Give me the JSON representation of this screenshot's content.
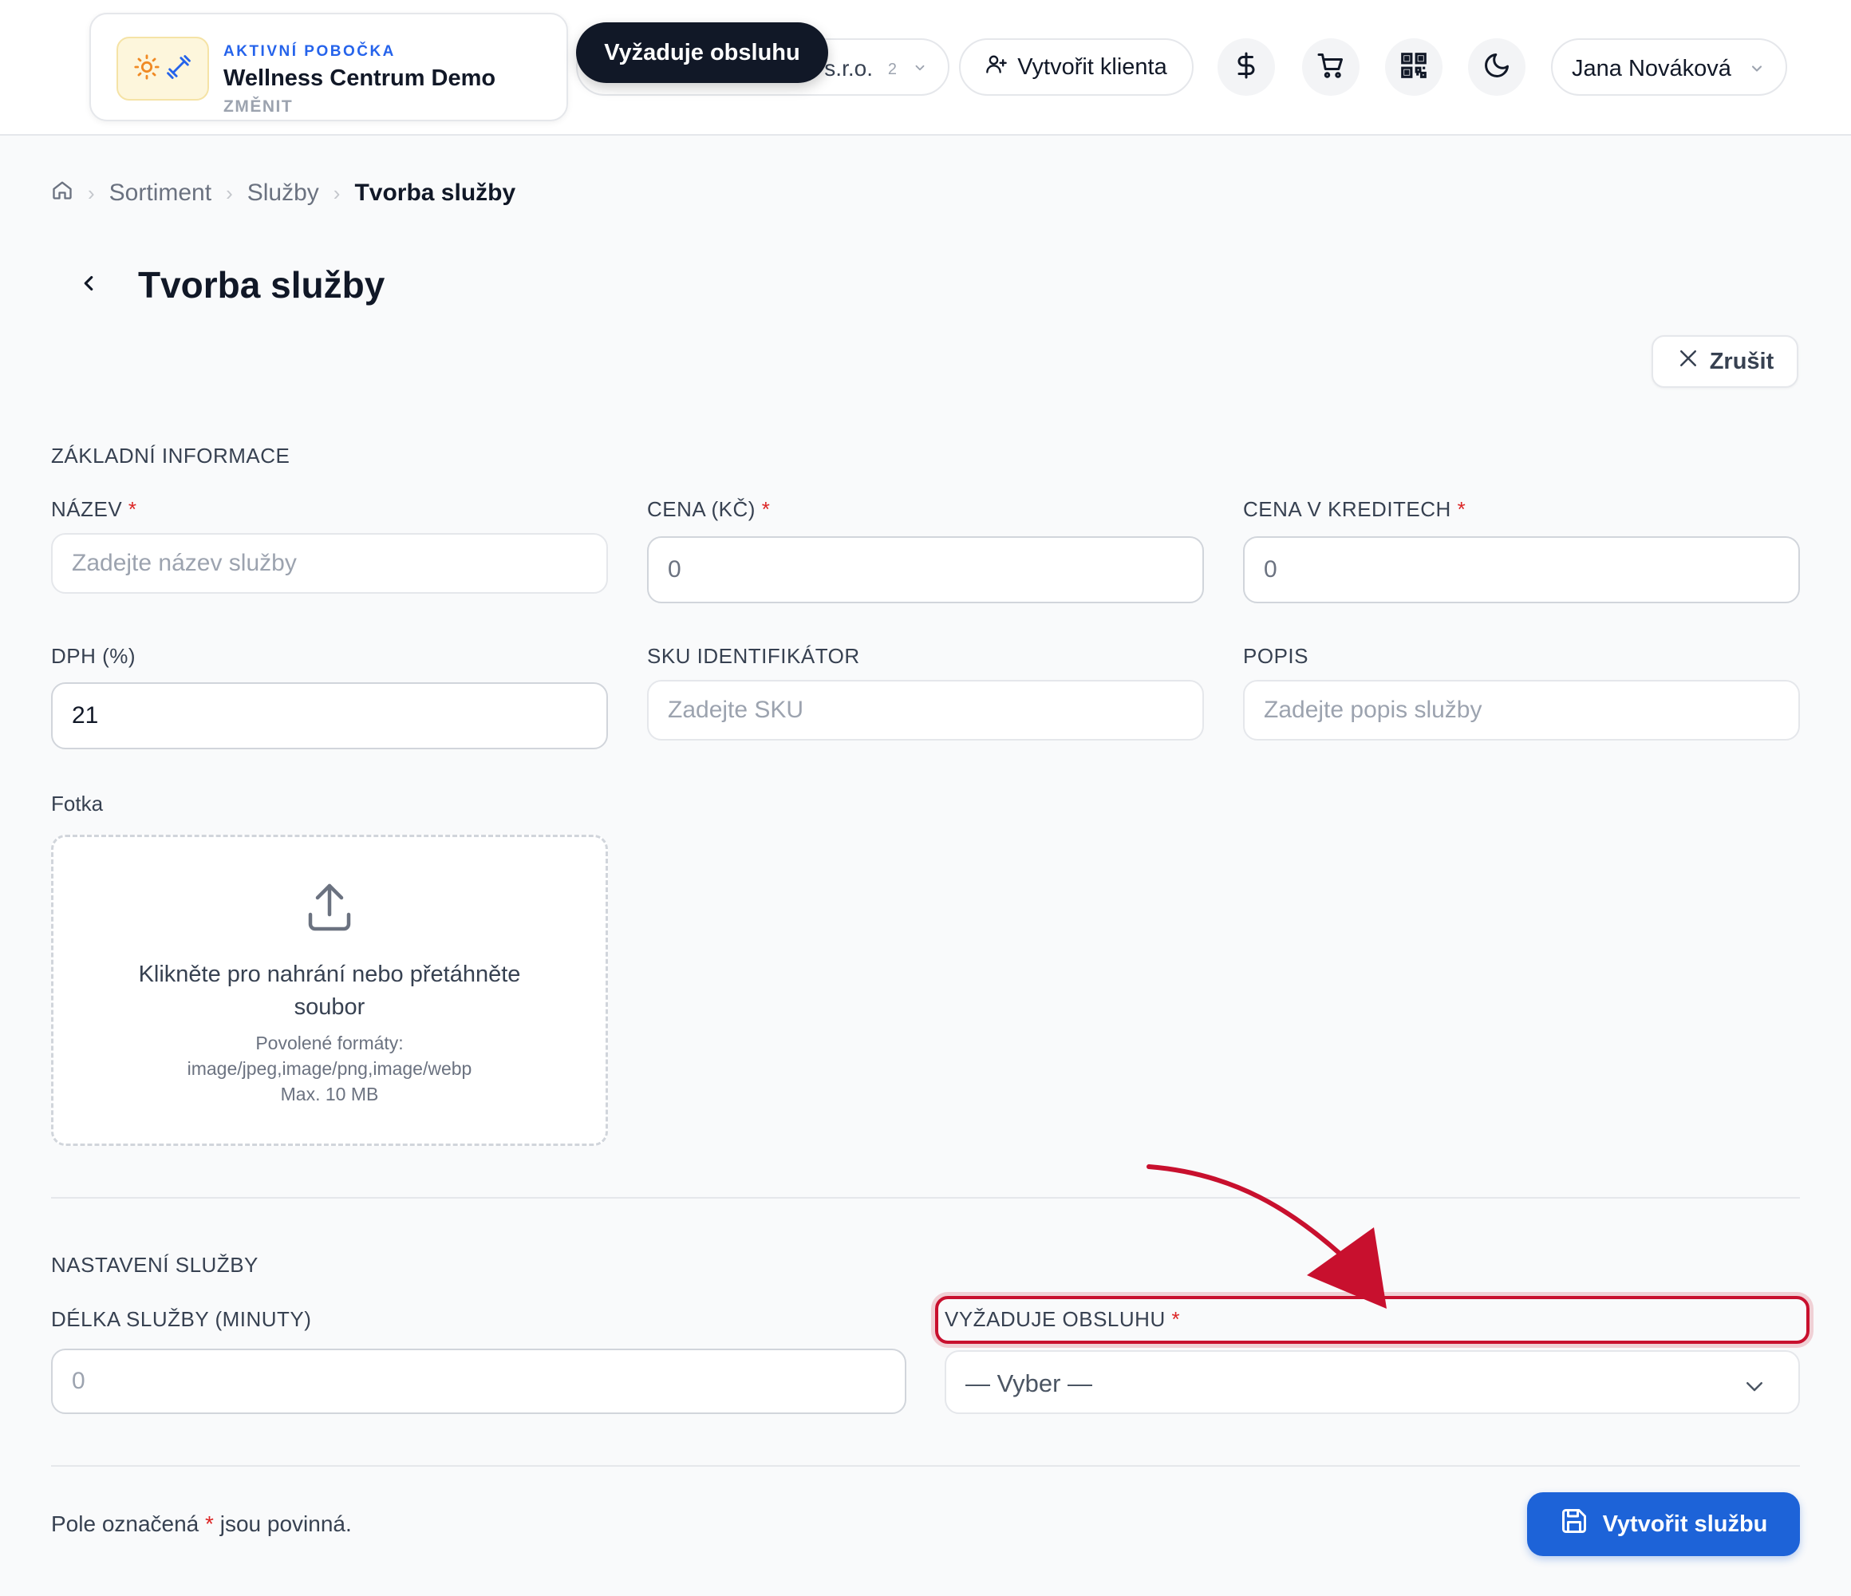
{
  "header": {
    "branch": {
      "kicker": "AKTIVNÍ POBOČKA",
      "name": "Wellness Centrum Demo",
      "change_label": "ZMĚNIT"
    },
    "company": {
      "name": "s.r.o.",
      "count": "2"
    },
    "tooltip": "Vyžaduje obsluhu",
    "create_client_label": "Vytvořit klienta",
    "icons": [
      "dollar-icon",
      "cart-icon",
      "qr-code-icon",
      "moon-icon"
    ],
    "user_name": "Jana Nováková"
  },
  "breadcrumb": {
    "items": [
      "Sortiment",
      "Služby"
    ],
    "current": "Tvorba služby"
  },
  "page": {
    "title": "Tvorba služby",
    "cancel_label": "Zrušit"
  },
  "form": {
    "basic_section": "ZÁKLADNÍ INFORMACE",
    "name": {
      "label": "NÁZEV",
      "placeholder": "Zadejte název služby",
      "value": ""
    },
    "price": {
      "label": "CENA (KČ)",
      "value": "0"
    },
    "credits": {
      "label": "CENA V KREDITECH",
      "value": "0"
    },
    "vat": {
      "label": "DPH (%)",
      "value": "21"
    },
    "sku": {
      "label": "SKU IDENTIFIKÁTOR",
      "placeholder": "Zadejte SKU",
      "value": ""
    },
    "description": {
      "label": "POPIS",
      "placeholder": "Zadejte popis služby",
      "value": ""
    },
    "photo": {
      "label": "Fotka",
      "main_text": "Klikněte pro nahrání nebo přetáhněte soubor",
      "formats_label": "Povolené formáty:",
      "formats": "image/jpeg,image/png,image/webp",
      "max_size": "Max. 10 MB"
    },
    "settings_section": "NASTAVENÍ SLUŽBY",
    "duration": {
      "label": "DÉLKA SLUŽBY (MINUTY)",
      "value": "0"
    },
    "requires_staff": {
      "label": "VYŽADUJE OBSLUHU",
      "selected": "— Vyber —"
    },
    "required_star": "*",
    "footer_note_before": "Pole označená",
    "footer_note_after": "jsou povinná.",
    "submit_label": "Vytvořit službu"
  },
  "colors": {
    "primary": "#1d63d8",
    "accent_blue": "#2563eb",
    "required": "#dc2626",
    "annotation_red": "#c8102e",
    "tooltip_bg": "#111827"
  }
}
